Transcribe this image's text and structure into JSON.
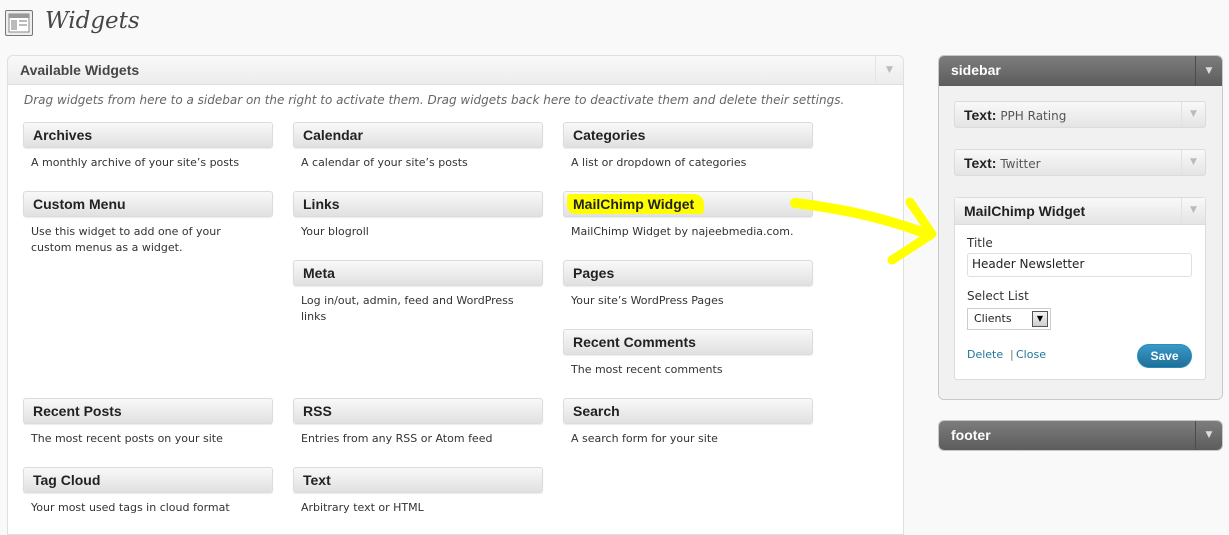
{
  "page": {
    "title": "Widgets",
    "icon": "widgets-icon"
  },
  "available": {
    "title": "Available Widgets",
    "description": "Drag widgets from here to a sidebar on the right to activate them. Drag widgets back here to deactivate them and delete their settings.",
    "widgets": [
      {
        "name": "Archives",
        "desc": "A monthly archive of your site’s posts"
      },
      {
        "name": "Calendar",
        "desc": "A calendar of your site’s posts"
      },
      {
        "name": "Categories",
        "desc": "A list or dropdown of categories"
      },
      {
        "name": "Custom Menu",
        "desc": "Use this widget to add one of your custom menus as a widget."
      },
      {
        "name": "Links",
        "desc": "Your blogroll"
      },
      {
        "name": "MailChimp Widget",
        "desc": "MailChimp Widget by najeebmedia.com."
      },
      {
        "name": "Meta",
        "desc": "Log in/out, admin, feed and WordPress links"
      },
      {
        "name": "Pages",
        "desc": "Your site’s WordPress Pages"
      },
      {
        "name": "Recent Comments",
        "desc": "The most recent comments"
      },
      {
        "name": "Recent Posts",
        "desc": "The most recent posts on your site"
      },
      {
        "name": "RSS",
        "desc": "Entries from any RSS or Atom feed"
      },
      {
        "name": "Search",
        "desc": "A search form for your site"
      },
      {
        "name": "Tag Cloud",
        "desc": "Your most used tags in cloud format"
      },
      {
        "name": "Text",
        "desc": "Arbitrary text or HTML"
      }
    ]
  },
  "sidebar": {
    "title": "sidebar",
    "widgets": [
      {
        "type": "Text:",
        "title": "PPH Rating"
      },
      {
        "type": "Text:",
        "title": "Twitter"
      }
    ],
    "mailchimp": {
      "title": "MailChimp Widget",
      "title_label": "Title",
      "title_value": "Header Newsletter",
      "list_label": "Select List",
      "list_value": "Clients",
      "delete_label": "Delete",
      "separator": "|",
      "close_label": "Close",
      "save_label": "Save"
    }
  },
  "footer": {
    "title": "footer"
  },
  "colors": {
    "highlight": "#ffff00",
    "link": "#21759b",
    "save_button": "#21759b"
  }
}
